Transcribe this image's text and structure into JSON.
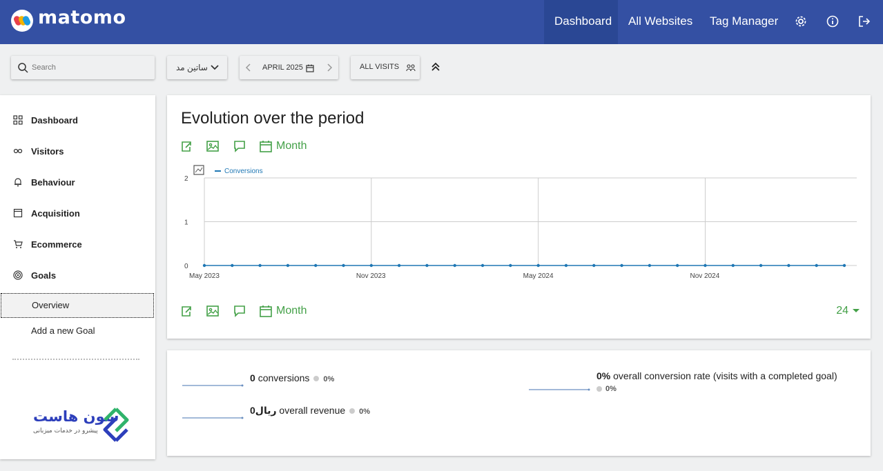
{
  "header": {
    "brand": "matomo",
    "nav": [
      "Dashboard",
      "All Websites",
      "Tag Manager"
    ],
    "active_nav": "Dashboard"
  },
  "controls": {
    "search_placeholder": "Search",
    "site": "ساتین مد",
    "period": "APRIL 2025",
    "segment": "ALL VISITS"
  },
  "sidebar": {
    "items": [
      {
        "label": "Dashboard",
        "icon": "dashboard-icon"
      },
      {
        "label": "Visitors",
        "icon": "visitors-icon"
      },
      {
        "label": "Behaviour",
        "icon": "bell-icon"
      },
      {
        "label": "Acquisition",
        "icon": "acquisition-icon"
      },
      {
        "label": "Ecommerce",
        "icon": "cart-icon"
      },
      {
        "label": "Goals",
        "icon": "target-icon"
      }
    ],
    "subitems": [
      {
        "label": "Overview",
        "active": true
      },
      {
        "label": "Add a new Goal",
        "active": false
      }
    ],
    "company": {
      "name": "سون هاست",
      "tagline": "پیشرو در خدمات میزبانی"
    }
  },
  "evolution": {
    "title": "Evolution over the period",
    "period_label": "Month",
    "limit": "24"
  },
  "chart_data": {
    "type": "line",
    "legend": "Conversions",
    "ylim": [
      0,
      2
    ],
    "yticks": [
      "0",
      "1",
      "2"
    ],
    "xticks": [
      "May 2023",
      "Nov 2023",
      "May 2024",
      "Nov 2024"
    ],
    "x": [
      "2023-05",
      "2023-06",
      "2023-07",
      "2023-08",
      "2023-09",
      "2023-10",
      "2023-11",
      "2023-12",
      "2024-01",
      "2024-02",
      "2024-03",
      "2024-04",
      "2024-05",
      "2024-06",
      "2024-07",
      "2024-08",
      "2024-09",
      "2024-10",
      "2024-11",
      "2024-12",
      "2025-01",
      "2025-02",
      "2025-03",
      "2025-04"
    ],
    "series": [
      {
        "name": "Conversions",
        "values": [
          0,
          0,
          0,
          0,
          0,
          0,
          0,
          0,
          0,
          0,
          0,
          0,
          0,
          0,
          0,
          0,
          0,
          0,
          0,
          0,
          0,
          0,
          0,
          0
        ]
      }
    ],
    "colors": {
      "line": "#1f77b4",
      "grid": "#cccccc"
    }
  },
  "sparklines": {
    "conversions": {
      "value": "0",
      "label": "conversions",
      "change": "0%"
    },
    "revenue": {
      "value": "0ریال",
      "label": "overall revenue",
      "change": "0%"
    },
    "rate": {
      "value": "0%",
      "label": "overall conversion rate (visits with a completed goal)",
      "change": "0%"
    }
  },
  "colors": {
    "header": "#3450a3",
    "accent_green": "#43a047"
  }
}
